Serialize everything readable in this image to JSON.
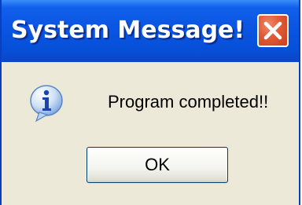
{
  "window": {
    "title": "System Message!",
    "close_icon": "close-icon"
  },
  "dialog": {
    "icon": "info-icon",
    "message": "Program completed!!",
    "ok_label": "OK"
  },
  "colors": {
    "titlebar": "#0a55e2",
    "body": "#ece9d8",
    "close_button": "#e05a36"
  }
}
